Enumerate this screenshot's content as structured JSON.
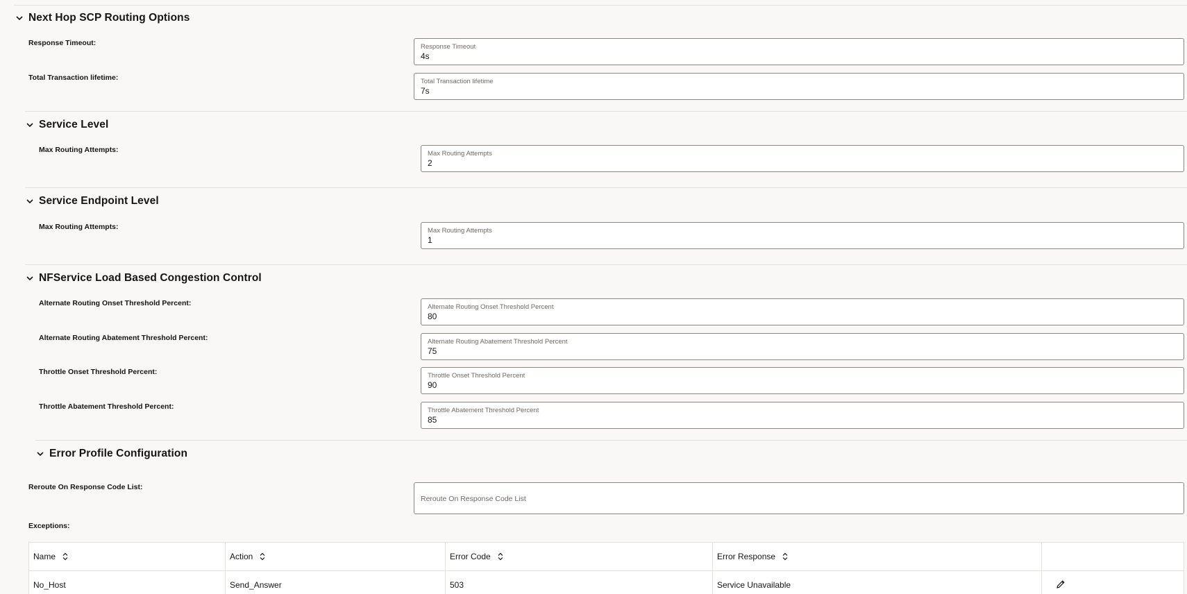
{
  "sections": {
    "next_hop": {
      "title": "Next Hop SCP Routing Options"
    },
    "service_level": {
      "title": "Service Level"
    },
    "service_endpoint_level": {
      "title": "Service Endpoint Level"
    },
    "nfservice_congestion": {
      "title": "NFService Load Based Congestion Control"
    },
    "error_profile": {
      "title": "Error Profile Configuration"
    }
  },
  "fields": {
    "response_timeout": {
      "label": "Response Timeout:",
      "float_label": "Response Timeout",
      "value": "4s"
    },
    "total_transaction_lifetime": {
      "label": "Total Transaction lifetime:",
      "float_label": "Total Transaction lifetime",
      "value": "7s"
    },
    "service_level_max_routing": {
      "label": "Max Routing Attempts:",
      "float_label": "Max Routing Attempts",
      "value": "2"
    },
    "endpoint_level_max_routing": {
      "label": "Max Routing Attempts:",
      "float_label": "Max Routing Attempts",
      "value": "1"
    },
    "alt_onset": {
      "label": "Alternate Routing Onset Threshold Percent:",
      "float_label": "Alternate Routing Onset Threshold Percent",
      "value": "80"
    },
    "alt_abatement": {
      "label": "Alternate Routing Abatement Threshold Percent:",
      "float_label": "Alternate Routing Abatement Threshold Percent",
      "value": "75"
    },
    "throttle_onset": {
      "label": "Throttle Onset Threshold Percent:",
      "float_label": "Throttle Onset Threshold Percent",
      "value": "90"
    },
    "throttle_abatement": {
      "label": "Throttle Abatement Threshold Percent:",
      "float_label": "Throttle Abatement Threshold Percent",
      "value": "85"
    },
    "reroute_codes": {
      "label": "Reroute On Response Code List:",
      "placeholder": "Reroute On Response Code List",
      "value": ""
    }
  },
  "exceptions": {
    "label": "Exceptions:",
    "columns": [
      "Name",
      "Action",
      "Error Code",
      "Error Response"
    ],
    "rows": [
      {
        "name": "No_Host",
        "action": "Send_Answer",
        "error_code": "503",
        "error_response": "Service Unavailable"
      }
    ]
  },
  "icons": {
    "section_toggle": "chevron-down-icon",
    "column_sort": "sort-icon",
    "row_edit": "pencil-icon"
  },
  "colors": {
    "background": "#f9f8f6",
    "field_border": "#8b8680",
    "divider": "#e4e1dd",
    "text": "#161513",
    "muted_text": "#6f6a64"
  }
}
